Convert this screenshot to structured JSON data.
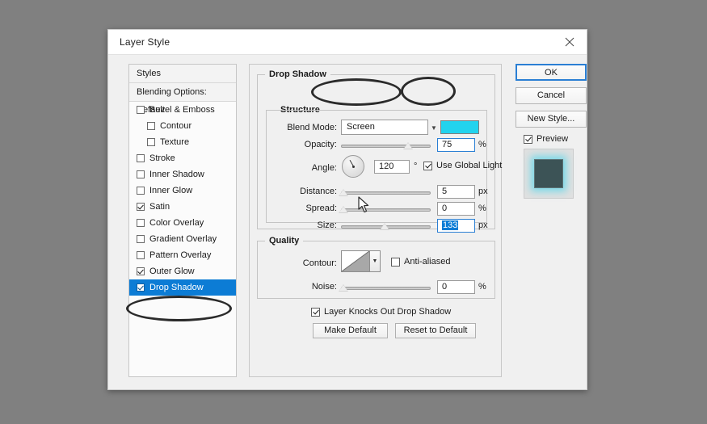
{
  "dialog": {
    "title": "Layer Style",
    "close_icon": "close-icon"
  },
  "styles_panel": {
    "header": "Styles",
    "blending_options": "Blending Options: Default",
    "items": [
      {
        "label": "Bevel & Emboss",
        "checked": false,
        "indent": false,
        "selected": false
      },
      {
        "label": "Contour",
        "checked": false,
        "indent": true,
        "selected": false
      },
      {
        "label": "Texture",
        "checked": false,
        "indent": true,
        "selected": false
      },
      {
        "label": "Stroke",
        "checked": false,
        "indent": false,
        "selected": false
      },
      {
        "label": "Inner Shadow",
        "checked": false,
        "indent": false,
        "selected": false
      },
      {
        "label": "Inner Glow",
        "checked": false,
        "indent": false,
        "selected": false
      },
      {
        "label": "Satin",
        "checked": true,
        "indent": false,
        "selected": false
      },
      {
        "label": "Color Overlay",
        "checked": false,
        "indent": false,
        "selected": false
      },
      {
        "label": "Gradient Overlay",
        "checked": false,
        "indent": false,
        "selected": false
      },
      {
        "label": "Pattern Overlay",
        "checked": false,
        "indent": false,
        "selected": false
      },
      {
        "label": "Outer Glow",
        "checked": true,
        "indent": false,
        "selected": false
      },
      {
        "label": "Drop Shadow",
        "checked": true,
        "indent": false,
        "selected": true
      }
    ]
  },
  "buttons": {
    "ok": "OK",
    "cancel": "Cancel",
    "new_style": "New Style...",
    "preview_label": "Preview",
    "preview_checked": true
  },
  "drop_shadow": {
    "group_title": "Drop Shadow",
    "structure_title": "Structure",
    "blend_mode_label": "Blend Mode:",
    "blend_mode_value": "Screen",
    "color_swatch": "#22d3ee",
    "opacity_label": "Opacity:",
    "opacity_value": "75",
    "opacity_unit": "%",
    "angle_label": "Angle:",
    "angle_value": "120",
    "angle_unit": "°",
    "use_global_light": "Use Global Light",
    "use_global_light_checked": true,
    "distance_label": "Distance:",
    "distance_value": "5",
    "distance_unit": "px",
    "spread_label": "Spread:",
    "spread_value": "0",
    "spread_unit": "%",
    "size_label": "Size:",
    "size_value": "133",
    "size_unit": "px"
  },
  "quality": {
    "group_title": "Quality",
    "contour_label": "Contour:",
    "anti_aliased_label": "Anti-aliased",
    "anti_aliased_checked": false,
    "noise_label": "Noise:",
    "noise_value": "0",
    "noise_unit": "%"
  },
  "footer": {
    "knockout_label": "Layer Knocks Out Drop Shadow",
    "knockout_checked": true,
    "make_default": "Make Default",
    "reset_to_default": "Reset to Default"
  },
  "colors": {
    "selection_blue": "#0c7cd5",
    "desktop_gray": "#808080",
    "dialog_bg": "#f0f0f0"
  }
}
